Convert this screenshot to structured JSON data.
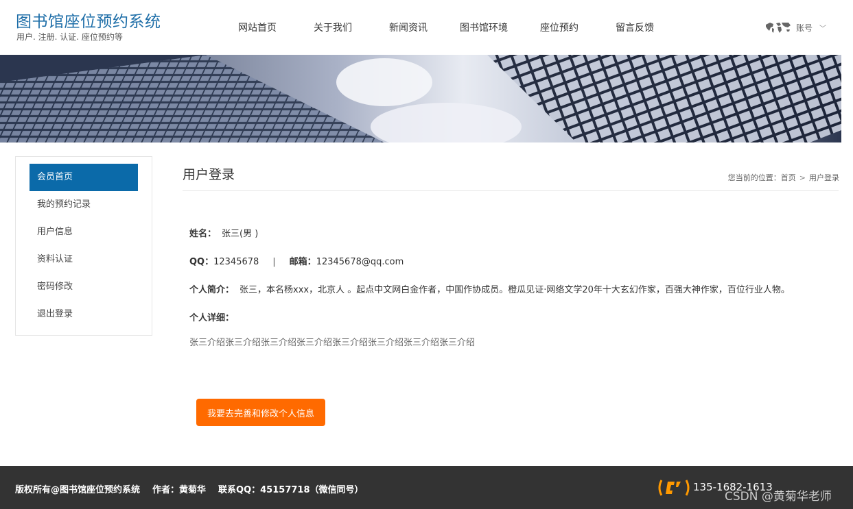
{
  "header": {
    "title": "图书馆座位预约系统",
    "subtitle": "用户. 注册. 认证. 座位预约等",
    "nav": [
      "网站首页",
      "关于我们",
      "新闻资讯",
      "图书馆环境",
      "座位预约",
      "留言反馈"
    ],
    "account_label": "账号",
    "account_chevron": "﹀"
  },
  "sidebar": {
    "items": [
      {
        "label": "会员首页",
        "active": true
      },
      {
        "label": "我的预约记录"
      },
      {
        "label": "用户信息"
      },
      {
        "label": "资料认证"
      },
      {
        "label": "密码修改"
      },
      {
        "label": "退出登录"
      }
    ]
  },
  "main": {
    "title": "用户登录",
    "breadcrumb": {
      "prefix": "您当前的位置：",
      "home": "首页",
      "sep": ">",
      "current": "用户登录"
    },
    "name": {
      "label": "姓名：",
      "value": "张三(男 )"
    },
    "qq": {
      "label": "QQ：",
      "value": "12345678"
    },
    "divider": "|",
    "email": {
      "label": "邮箱：",
      "value": "12345678@qq.com"
    },
    "intro": {
      "label": "个人简介：",
      "value": "张三，本名杨xxx，北京人 。起点中文网白金作者，中国作协成员。橙瓜见证·网络文学20年十大玄幻作家，百强大神作家，百位行业人物。"
    },
    "detail": {
      "label": "个人详细：",
      "value": "张三介绍张三介绍张三介绍张三介绍张三介绍张三介绍张三介绍张三介绍"
    },
    "edit_button": "我要去完善和修改个人信息"
  },
  "footer": {
    "copyright": "版权所有@图书馆座位预约系统",
    "author": "作者：黄菊华",
    "contact": "联系QQ：45157718（微信同号）",
    "phone": "135-1682-1613",
    "watermark": "CSDN @黄菊华老师"
  },
  "colors": {
    "brand": "#1e6ea8",
    "sidebar_active": "#0b6aa9",
    "button": "#ff6a00",
    "footer": "#333333",
    "phone_icon": "#ff9900"
  }
}
